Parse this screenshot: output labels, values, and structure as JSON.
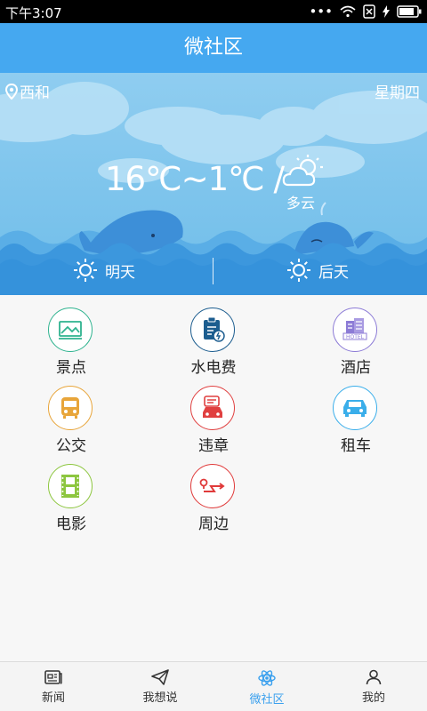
{
  "status": {
    "time": "下午3:07"
  },
  "header": {
    "title": "微社区"
  },
  "weather": {
    "location": "西和",
    "weekday": "星期四",
    "temperature": "16℃~1℃ /",
    "condition": "多云",
    "forecast": [
      {
        "label": "明天",
        "icon": "sun-icon"
      },
      {
        "label": "后天",
        "icon": "sun-icon"
      }
    ]
  },
  "services": [
    {
      "label": "景点",
      "icon": "scenery-icon",
      "color": "#2fb38f"
    },
    {
      "label": "水电费",
      "icon": "bill-icon",
      "color": "#1c5d8f"
    },
    {
      "label": "酒店",
      "icon": "hotel-icon",
      "color": "#8c7bd6"
    },
    {
      "label": "公交",
      "icon": "bus-icon",
      "color": "#e8a53a"
    },
    {
      "label": "违章",
      "icon": "violation-icon",
      "color": "#e04040"
    },
    {
      "label": "租车",
      "icon": "car-icon",
      "color": "#3aaeea"
    },
    {
      "label": "电影",
      "icon": "film-icon",
      "color": "#8dc63f"
    },
    {
      "label": "周边",
      "icon": "nearby-icon",
      "color": "#e03a3a"
    }
  ],
  "bottom_nav": [
    {
      "label": "新闻",
      "icon": "news-icon"
    },
    {
      "label": "我想说",
      "icon": "send-icon"
    },
    {
      "label": "微社区",
      "icon": "atom-icon",
      "active": true
    },
    {
      "label": "我的",
      "icon": "user-icon"
    }
  ]
}
